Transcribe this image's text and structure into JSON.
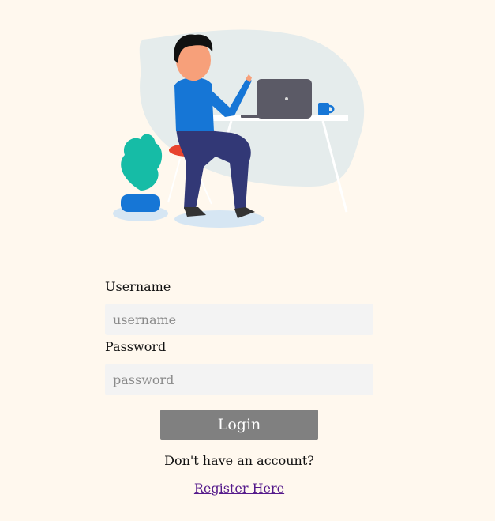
{
  "login_form": {
    "username_label": "Username",
    "username_placeholder": "username",
    "password_label": "Password",
    "password_placeholder": "password",
    "login_label": "Login",
    "no_account_text": "Don't have an account?",
    "register_label": "Register Here"
  },
  "colors": {
    "page_background": "#fff8ee",
    "input_background": "#f3f3f3",
    "button_background": "#808080",
    "link": "#551a8b"
  },
  "illustration": {
    "icon": "person-at-laptop-illustration"
  }
}
